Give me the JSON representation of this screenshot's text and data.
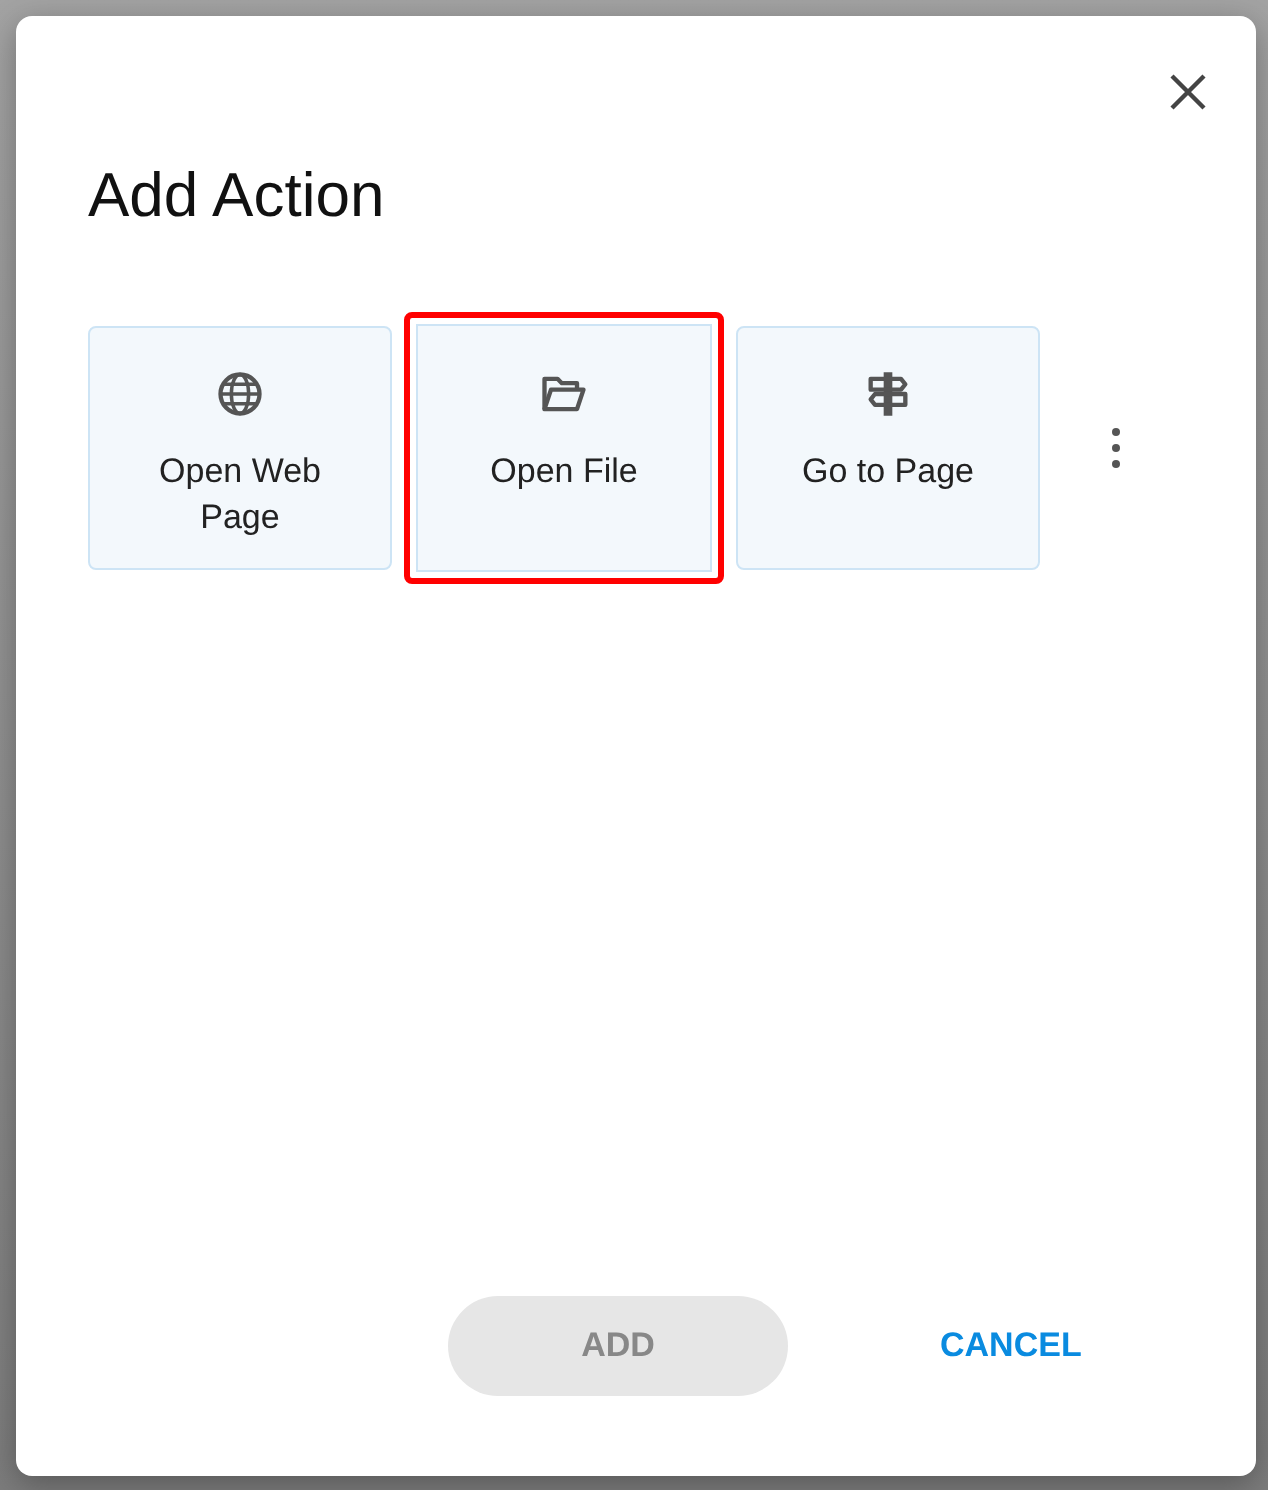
{
  "dialog": {
    "title": "Add Action",
    "actions": [
      {
        "label": "Open Web Page",
        "kind": "globe",
        "selected": false
      },
      {
        "label": "Open File",
        "kind": "folder",
        "selected": true
      },
      {
        "label": "Go to Page",
        "kind": "signpost",
        "selected": false
      }
    ],
    "add_button": {
      "label": "ADD",
      "disabled": true
    },
    "cancel_button": {
      "label": "CANCEL"
    }
  }
}
